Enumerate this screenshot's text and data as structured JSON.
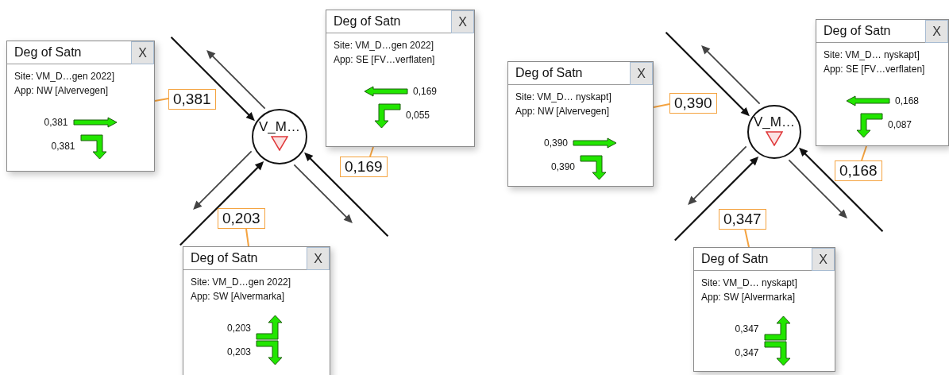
{
  "diagrams": [
    {
      "node": {
        "label": "V_M…"
      },
      "links": [
        {
          "kind": "nw",
          "value": "0,381",
          "popup": {
            "title": "Deg of Satn",
            "close": "X",
            "site": "Site: VM_D…gen 2022]",
            "app": "App: NW [Alvervegen]",
            "movements": [
              {
                "kind": "east",
                "value": "0,381"
              },
              {
                "kind": "turn_down",
                "value": "0,381"
              }
            ]
          }
        },
        {
          "kind": "se",
          "value": "0,169",
          "popup": {
            "title": "Deg of Satn",
            "close": "X",
            "site": "Site: VM_D…gen 2022]",
            "app": "App: SE [FV…verflaten]",
            "movements": [
              {
                "kind": "west",
                "value": "0,169"
              },
              {
                "kind": "west_turn_down",
                "value": "0,055"
              }
            ]
          }
        },
        {
          "kind": "sw",
          "value": "0,203",
          "popup": {
            "title": "Deg of Satn",
            "close": "X",
            "site": "Site: VM_D…gen 2022]",
            "app": "App: SW [Alvermarka]",
            "movements": [
              {
                "kind": "turn_up",
                "value": "0,203"
              },
              {
                "kind": "turn_down",
                "value": "0,203"
              }
            ]
          }
        }
      ]
    },
    {
      "node": {
        "label": "V_M…"
      },
      "links": [
        {
          "kind": "nw",
          "value": "0,390",
          "popup": {
            "title": "Deg of Satn",
            "close": "X",
            "site": "Site: VM_D… nyskapt]",
            "app": "App: NW [Alvervegen]",
            "movements": [
              {
                "kind": "east",
                "value": "0,390"
              },
              {
                "kind": "turn_down",
                "value": "0,390"
              }
            ]
          }
        },
        {
          "kind": "se",
          "value": "0,168",
          "popup": {
            "title": "Deg of Satn",
            "close": "X",
            "site": "Site: VM_D… nyskapt]",
            "app": "App: SE [FV…verflaten]",
            "movements": [
              {
                "kind": "west",
                "value": "0,168"
              },
              {
                "kind": "west_turn_down",
                "value": "0,087"
              }
            ]
          }
        },
        {
          "kind": "sw",
          "value": "0,347",
          "popup": {
            "title": "Deg of Satn",
            "close": "X",
            "site": "Site: VM_D… nyskapt]",
            "app": "App: SW [Alvermarka]",
            "movements": [
              {
                "kind": "turn_up",
                "value": "0,347"
              },
              {
                "kind": "turn_down",
                "value": "0,347"
              }
            ]
          }
        }
      ]
    }
  ]
}
